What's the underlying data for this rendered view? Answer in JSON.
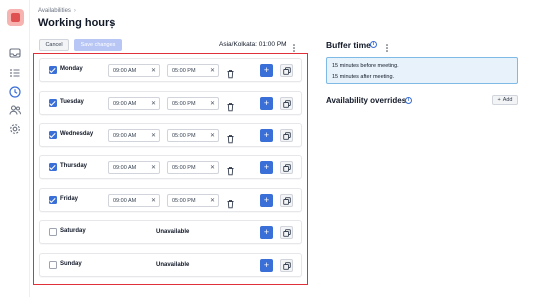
{
  "sidebar": {
    "logo": "calendar-logo",
    "icons": [
      "inbox-icon",
      "list-icon",
      "clock-icon",
      "users-icon",
      "settings-icon"
    ]
  },
  "header": {
    "breadcrumb": "Availabilities",
    "title": "Working hours",
    "cancel_label": "Cancel",
    "save_label": "Save changes",
    "timezone": "Asia/Kolkata: 01:00 PM"
  },
  "schedule": {
    "unavailable_label": "Unavailable",
    "days": [
      {
        "name": "Monday",
        "enabled": true,
        "start": "09:00 AM",
        "end": "05:00 PM"
      },
      {
        "name": "Tuesday",
        "enabled": true,
        "start": "09:00 AM",
        "end": "05:00 PM"
      },
      {
        "name": "Wednesday",
        "enabled": true,
        "start": "09:00 AM",
        "end": "05:00 PM"
      },
      {
        "name": "Thursday",
        "enabled": true,
        "start": "09:00 AM",
        "end": "05:00 PM"
      },
      {
        "name": "Friday",
        "enabled": true,
        "start": "09:00 AM",
        "end": "05:00 PM"
      },
      {
        "name": "Saturday",
        "enabled": false,
        "start": "",
        "end": ""
      },
      {
        "name": "Sunday",
        "enabled": false,
        "start": "",
        "end": ""
      }
    ]
  },
  "buffer": {
    "title": "Buffer time",
    "lines": [
      "15 minutes before meeting.",
      "15 minutes after meeting."
    ]
  },
  "overrides": {
    "title": "Availability overrides",
    "add_label": "Add"
  },
  "colors": {
    "accent": "#3b6fd8",
    "highlight_border": "#e0313a",
    "buffer_bg": "#e7f2fb"
  }
}
